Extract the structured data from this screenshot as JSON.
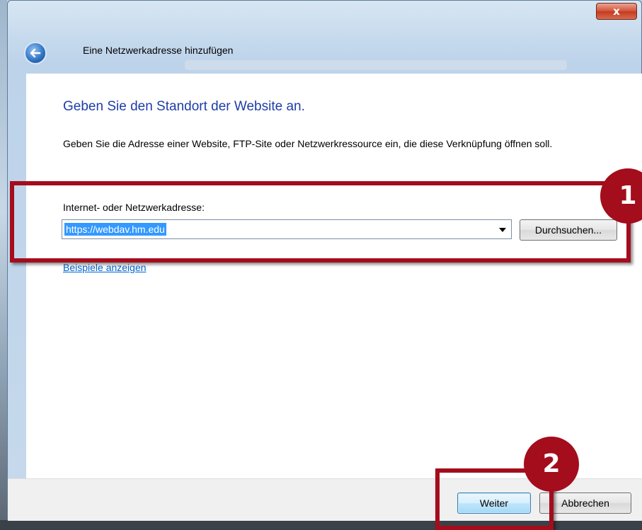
{
  "window": {
    "title": "Eine Netzwerkadresse hinzufügen",
    "close_label": "x"
  },
  "content": {
    "heading": "Geben Sie den Standort der Website an.",
    "description": "Geben Sie die Adresse einer Website, FTP-Site oder Netzwerkressource ein, die diese Verknüpfung öffnen soll.",
    "address_label": "Internet- oder Netzwerkadresse:",
    "address_value": "https://webdav.hm.edu",
    "browse_label": "Durchsuchen...",
    "examples_link": "Beispiele anzeigen"
  },
  "footer": {
    "next_label": "Weiter",
    "cancel_label": "Abbrechen"
  },
  "annotations": {
    "badge_1": "1",
    "badge_2": "2",
    "color": "#a40d1c"
  }
}
